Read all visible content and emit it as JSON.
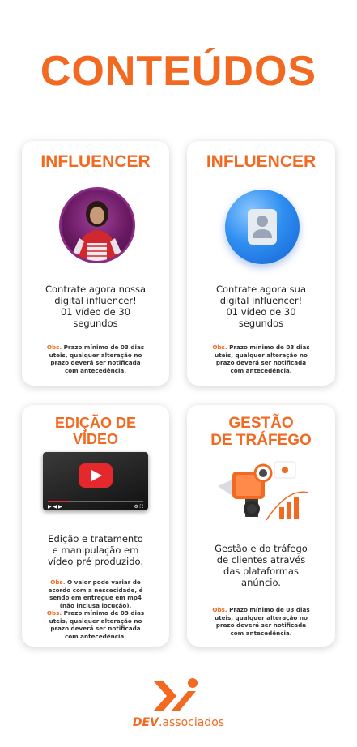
{
  "page": {
    "title": "CONTEÚDOS"
  },
  "cards": [
    {
      "title": "INFLUENCER",
      "description": [
        "Contrate agora nossa",
        "digital influencer!",
        "01 vídeo de 30",
        "segundos"
      ],
      "obs_label": "Obs.",
      "obs": [
        " Prazo mínimo de 03 dias",
        "uteis, qualquer alteração no",
        "prazo deverá ser notificada",
        "com antecedência."
      ]
    },
    {
      "title": "INFLUENCER",
      "description": [
        "Contrate agora sua",
        "digital influencer!",
        "01 vídeo de 30",
        "segundos"
      ],
      "obs_label": "Obs.",
      "obs": [
        " Prazo mínimo de 03 dias",
        "uteis, qualquer alteração no",
        "prazo deverá ser notificada",
        "com antecedência."
      ]
    },
    {
      "title": [
        "EDIÇÃO DE",
        "VÍDEO"
      ],
      "description": [
        "Edição e tratamento",
        "e manipulação em",
        "vídeo pré produzido."
      ],
      "obs_label": "Obs.",
      "obs": [
        " O valor pode variar de",
        "acordo com a nescecidade, é",
        "sendo em entregue em mp4",
        "(não inclusa locução)."
      ],
      "obs2_label": "Obs.",
      "obs2": [
        " Prazo mínimo de 03 dias",
        "uteis, qualquer alteração no",
        "prazo deverá ser notificada",
        "com antecedência."
      ]
    },
    {
      "title": [
        "GESTÃO",
        "DE TRÁFEGO"
      ],
      "description": [
        "Gestão e do tráfego",
        "de clientes através",
        "das plataformas",
        "anúncio."
      ],
      "obs_label": "Obs.",
      "obs": [
        " Prazo mínimo de 03 dias",
        "uteis, qualquer alteração no",
        "prazo deverá ser notificada",
        "com antecedência."
      ]
    }
  ],
  "brand": {
    "strong": "DEV",
    "rest": ".associados"
  },
  "colors": {
    "accent": "#f26a21",
    "text": "#222222",
    "youtube": "#e4282c",
    "avatar": "#2f8ff0"
  }
}
